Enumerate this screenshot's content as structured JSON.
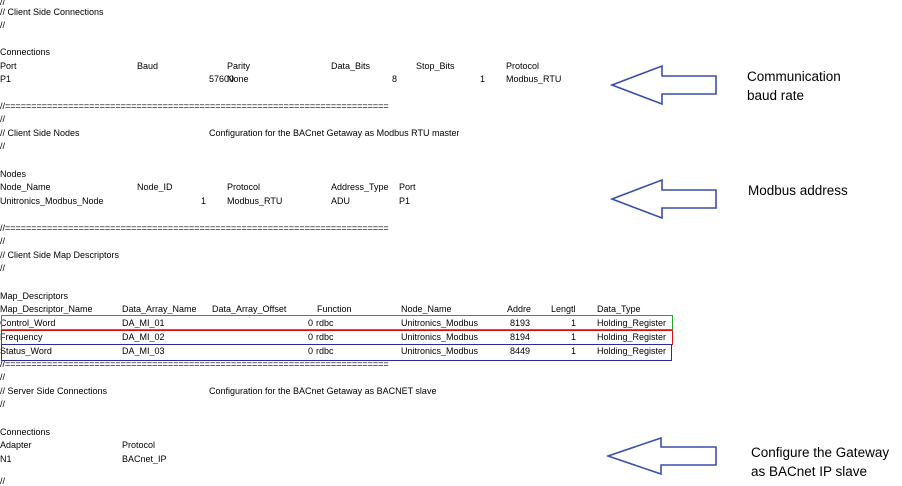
{
  "sections": {
    "client_connections": {
      "comment_lines": [
        "//",
        "//   Client Side Connections",
        "//"
      ],
      "heading": "Connections",
      "headers": [
        "Port",
        "Baud",
        "Parity",
        "Data_Bits",
        "Stop_Bits",
        "Protocol"
      ],
      "row": [
        "P1",
        "57600",
        "None",
        "8",
        "1",
        "Modbus_RTU"
      ],
      "separator": "//========================================================================="
    },
    "client_nodes": {
      "comment_lines": [
        "//",
        "//   Client Side Nodes",
        "//"
      ],
      "config_note": "Configuration for the BACnet Getaway as Modbus RTU master",
      "heading": "Nodes",
      "headers": [
        "Node_Name",
        "Node_ID",
        "Protocol",
        "Address_Type",
        "Port"
      ],
      "row": [
        "Unitronics_Modbus_Node",
        "1",
        "Modbus_RTU",
        "ADU",
        "P1"
      ],
      "separator": "//========================================================================="
    },
    "map_descriptors": {
      "comment_lines": [
        "//",
        "//   Client Side Map Descriptors",
        "//"
      ],
      "heading": "Map_Descriptors",
      "headers": [
        "Map_Descriptor_Name",
        "Data_Array_Name",
        "Data_Array_Offset",
        "Function",
        "Node_Name",
        "Addre",
        "Lengtl",
        "Data_Type"
      ],
      "rows": [
        [
          "Control_Word",
          "DA_MI_01",
          "0",
          "rdbc",
          "Unitronics_Modbus",
          "8193",
          "1",
          "Holding_Register"
        ],
        [
          "Frequency",
          "DA_MI_02",
          "0",
          "rdbc",
          "Unitronics_Modbus",
          "8194",
          "1",
          "Holding_Register"
        ],
        [
          "Status_Word",
          "DA_MI_03",
          "0",
          "rdbc",
          "Unitronics_Modbus",
          "8449",
          "1",
          "Holding_Register"
        ]
      ],
      "separator": "//========================================================================="
    },
    "server_connections": {
      "comment_lines": [
        "//",
        "//   Server Side Connections",
        "//"
      ],
      "config_note": "Configuration for the BACnet Getaway as BACNET slave",
      "heading": "Connections",
      "headers": [
        "Adapter",
        "Protocol"
      ],
      "row": [
        "N1",
        "BACnet_IP"
      ],
      "trailing": "//"
    }
  },
  "callouts": {
    "baud": [
      "Communication",
      "baud rate"
    ],
    "modbus": [
      "Modbus address"
    ],
    "gateway": [
      "Configure the Gateway",
      "as BACnet IP slave"
    ]
  },
  "colors": {
    "arrow": "#3a4fa8",
    "highlight_green": "#22aa22",
    "highlight_red": "#dd1111",
    "highlight_blue": "#2a2aa0"
  }
}
